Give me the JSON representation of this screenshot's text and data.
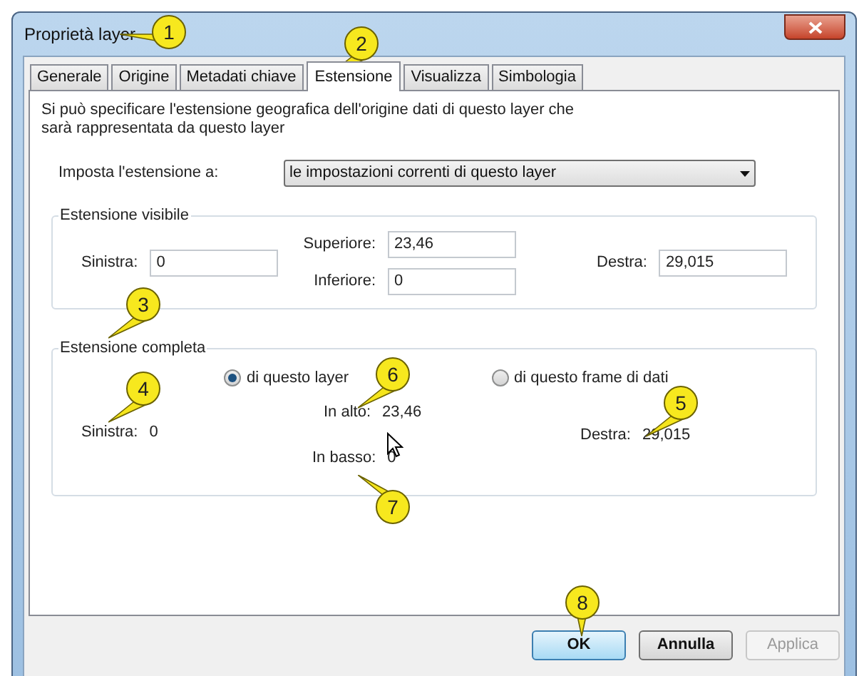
{
  "window": {
    "title": "Proprietà layer"
  },
  "tabs": [
    {
      "label": "Generale",
      "selected": false
    },
    {
      "label": "Origine",
      "selected": false
    },
    {
      "label": "Metadati chiave",
      "selected": false
    },
    {
      "label": "Estensione",
      "selected": true
    },
    {
      "label": "Visualizza",
      "selected": false
    },
    {
      "label": "Simbologia",
      "selected": false
    }
  ],
  "description": "Si può specificare l'estensione geografica dell'origine dati di questo layer che sarà rappresentata da questo layer",
  "extent_setting": {
    "label": "Imposta l'estensione a:",
    "value": "le impostazioni correnti di questo layer"
  },
  "visible_extent": {
    "title": "Estensione visibile",
    "left": {
      "label": "Sinistra:",
      "value": "0"
    },
    "top": {
      "label": "Superiore:",
      "value": "23,46"
    },
    "bottom": {
      "label": "Inferiore:",
      "value": "0"
    },
    "right": {
      "label": "Destra:",
      "value": "29,015"
    }
  },
  "full_extent": {
    "title": "Estensione completa",
    "options": [
      {
        "label": "di questo layer",
        "selected": true
      },
      {
        "label": "di questo frame di dati",
        "selected": false
      }
    ],
    "left": {
      "label": "Sinistra:",
      "value": "0"
    },
    "top": {
      "label": "In alto:",
      "value": "23,46"
    },
    "bottom": {
      "label": "In basso:",
      "value": "0"
    },
    "right": {
      "label": "Destra:",
      "value": "29,015"
    }
  },
  "buttons": [
    {
      "label": "OK",
      "kind": "default",
      "disabled": false
    },
    {
      "label": "Annulla",
      "kind": "normal",
      "disabled": false
    },
    {
      "label": "Applica",
      "kind": "normal",
      "disabled": true
    }
  ],
  "callouts": [
    "1",
    "2",
    "3",
    "4",
    "5",
    "6",
    "7",
    "8"
  ]
}
